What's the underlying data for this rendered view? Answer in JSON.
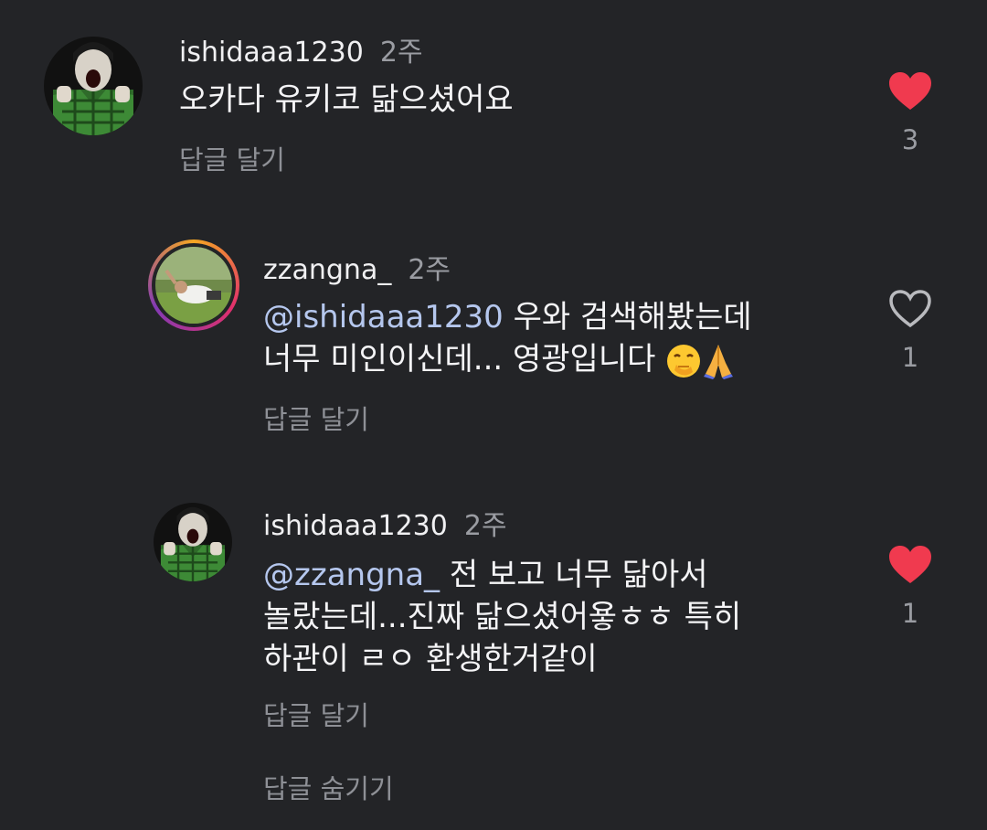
{
  "comments": [
    {
      "username": "ishidaaa1230",
      "time": "2주",
      "mention": "",
      "text_lines": [
        "오카다 유키코 닮으셨어요"
      ],
      "reply_label": "답글 달기",
      "likes": "3",
      "liked": true,
      "avatar": "manga-character-avatar"
    },
    {
      "username": "zzangna_",
      "time": "2주",
      "mention": "@ishidaaa1230",
      "text_lines": [
        " 우와 검색해봤는데",
        "너무 미인이신데... 영광입니다 "
      ],
      "emojis": [
        "face-with-hand-over-mouth-emoji",
        "folded-hands-emoji"
      ],
      "reply_label": "답글 달기",
      "likes": "1",
      "liked": false,
      "avatar": "story-ring-photo-avatar"
    },
    {
      "username": "ishidaaa1230",
      "time": "2주",
      "mention": "@zzangna_",
      "text_lines": [
        " 전 보고 너무 닮아서",
        "놀랐는데...진짜 닮으셨어욯ㅎㅎ 특히",
        "하관이 ㄹㅇ 환생한거같이"
      ],
      "reply_label": "답글 달기",
      "likes": "1",
      "liked": true,
      "avatar": "manga-character-avatar"
    }
  ],
  "hide_replies_label": "답글 숨기기",
  "colors": {
    "background": "#232427",
    "heart_liked": "#f03a4f",
    "heart_outline": "#b9babe",
    "mention": "#b5c7ee"
  }
}
